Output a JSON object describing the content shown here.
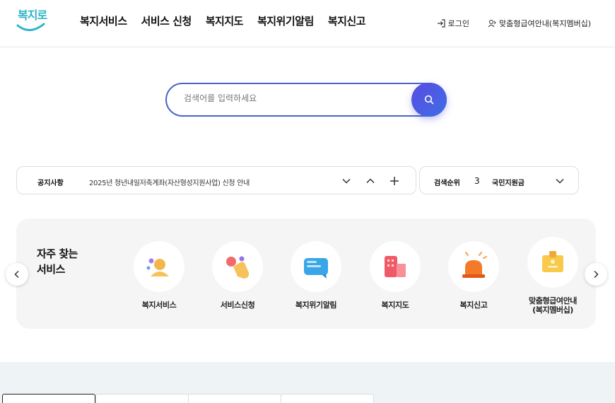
{
  "brand": {
    "logo_text": "복지로",
    "accent": "#2eb4c9"
  },
  "nav": {
    "items": [
      "복지서비스",
      "서비스 신청",
      "복지지도",
      "복지위기알림",
      "복지신고"
    ]
  },
  "util": {
    "login": "로그인",
    "membership": "맞춤형급여안내(복지멤버십)"
  },
  "search": {
    "placeholder": "검색어를 입력하세요",
    "button_color": "#4a5ee0"
  },
  "notice": {
    "label": "공지사항",
    "text": "2025년 청년내일저축계좌(자산형성지원사업) 신청 안내"
  },
  "rank": {
    "label": "검색순위",
    "number": "3",
    "keyword": "국민지원금"
  },
  "quick": {
    "title_line1": "자주 찾는",
    "title_line2": "서비스",
    "items": [
      {
        "label": "복지서비스",
        "icon": "person-icon"
      },
      {
        "label": "서비스신청",
        "icon": "hand-touch-icon"
      },
      {
        "label": "복지위기알림",
        "icon": "message-icon"
      },
      {
        "label": "복지지도",
        "icon": "building-icon"
      },
      {
        "label": "복지신고",
        "icon": "siren-icon"
      },
      {
        "label_line1": "맞춤형급여안내",
        "label_line2": "(복지멤버십)",
        "icon": "badge-icon"
      }
    ]
  }
}
